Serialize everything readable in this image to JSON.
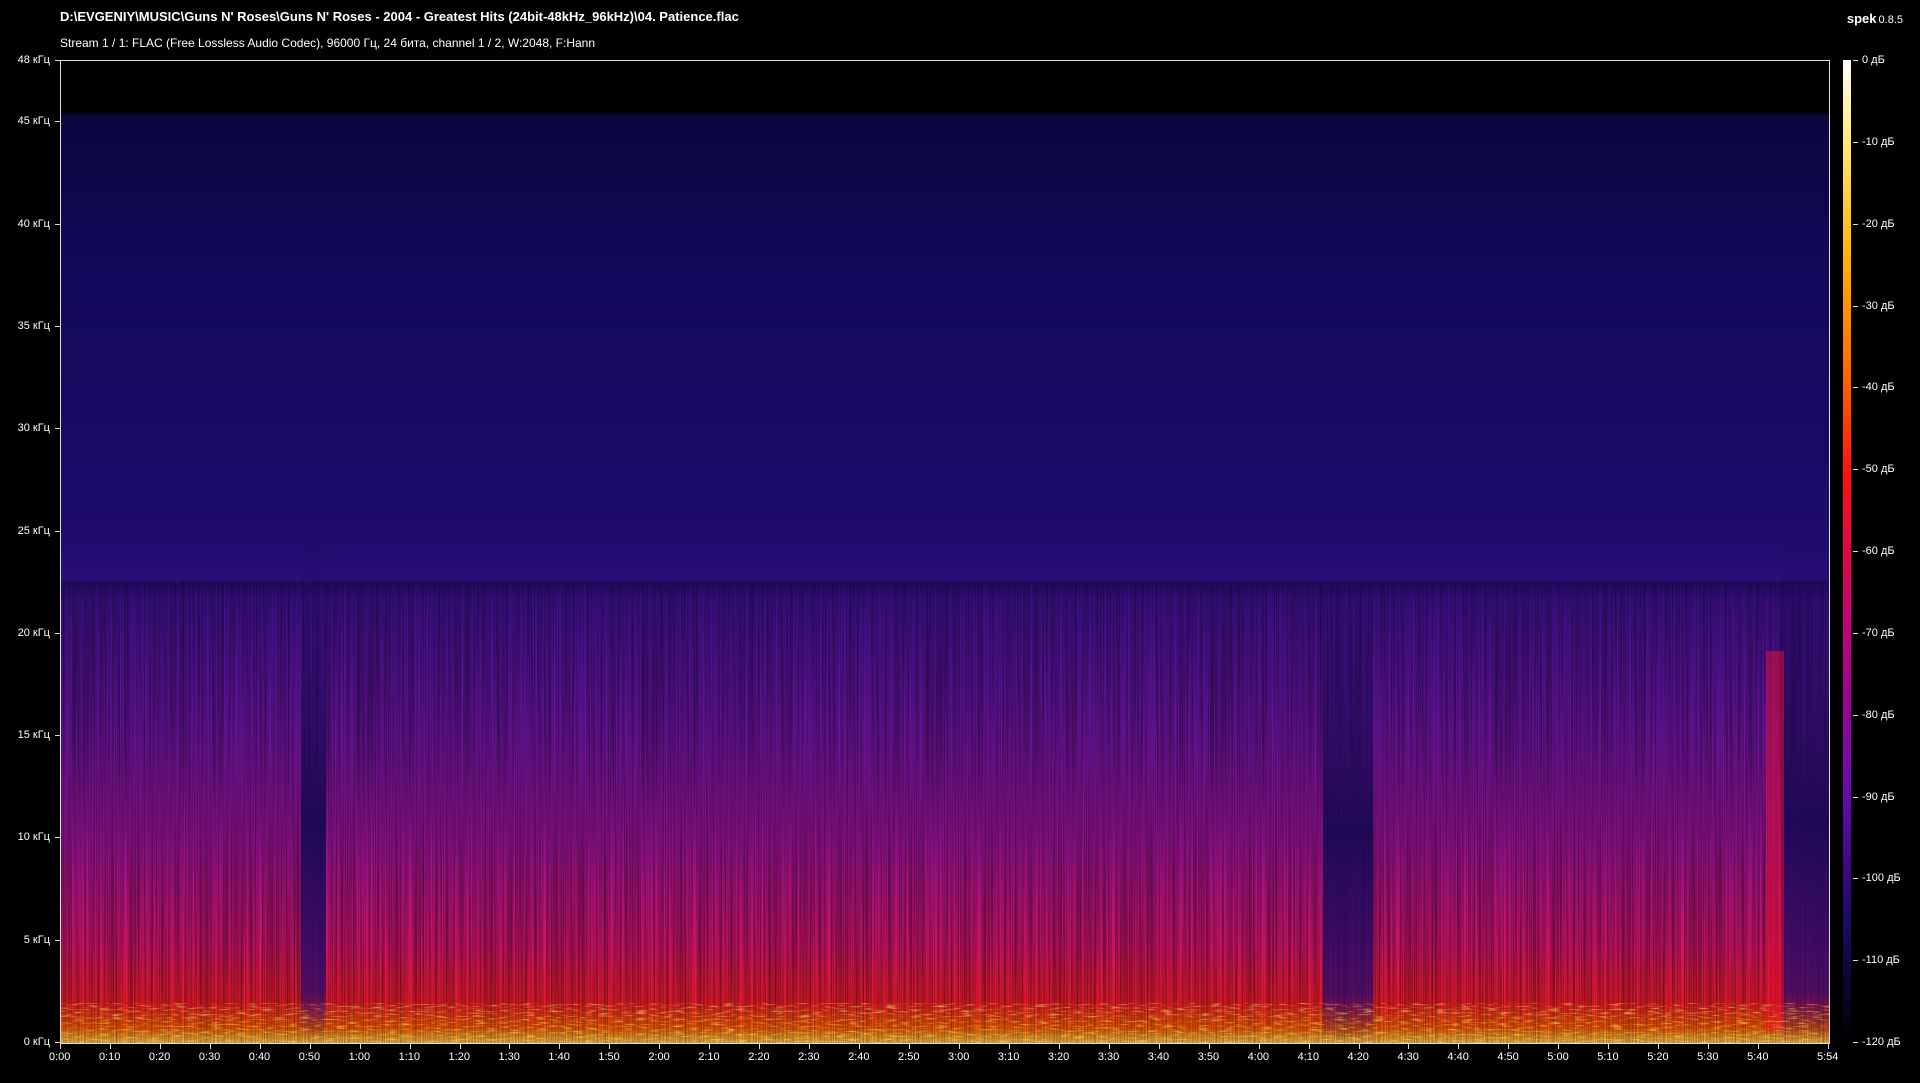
{
  "header": {
    "file_path": "D:\\EVGENIY\\MUSIC\\Guns N' Roses\\Guns N' Roses - 2004 - Greatest Hits (24bit-48kHz_96kHz)\\04. Patience.flac",
    "stream_info": "Stream 1 / 1: FLAC (Free Lossless Audio Codec), 96000 Гц, 24 бита, channel 1 / 2, W:2048, F:Hann",
    "app_name": "spek",
    "app_version": "0.8.5"
  },
  "chart_data": {
    "type": "heatmap",
    "title": "",
    "x_label": "",
    "y_label": "",
    "x_ticks": [
      "0:00",
      "0:10",
      "0:20",
      "0:30",
      "0:40",
      "0:50",
      "1:00",
      "1:10",
      "1:20",
      "1:30",
      "1:40",
      "1:50",
      "2:00",
      "2:10",
      "2:20",
      "2:30",
      "2:40",
      "2:50",
      "3:00",
      "3:10",
      "3:20",
      "3:30",
      "3:40",
      "3:50",
      "4:00",
      "4:10",
      "4:20",
      "4:30",
      "4:40",
      "4:50",
      "5:00",
      "5:10",
      "5:20",
      "5:30",
      "5:40",
      "5:54"
    ],
    "x_range_seconds": [
      0,
      354
    ],
    "y_ticks": [
      "0 кГц",
      "5 кГц",
      "10 кГц",
      "15 кГц",
      "20 кГц",
      "25 кГц",
      "30 кГц",
      "35 кГц",
      "40 кГц",
      "45 кГц",
      "48 кГц"
    ],
    "y_range_khz": [
      0,
      48
    ],
    "colorbar_ticks": [
      "0 дБ",
      "-10 дБ",
      "-20 дБ",
      "-30 дБ",
      "-40 дБ",
      "-50 дБ",
      "-60 дБ",
      "-70 дБ",
      "-80 дБ",
      "-90 дБ",
      "-100 дБ",
      "-110 дБ",
      "-120 дБ"
    ],
    "colorbar_range_db": [
      -120,
      0
    ],
    "colors": {
      "background": "#000000",
      "low": "#1b0a63",
      "mid": "#c0007a",
      "high": "#ff2a00",
      "peak": "#ffe97a"
    },
    "observations": {
      "spectrum_cutoff_khz": 45.5,
      "energetic_band_top_khz": 22
    }
  }
}
